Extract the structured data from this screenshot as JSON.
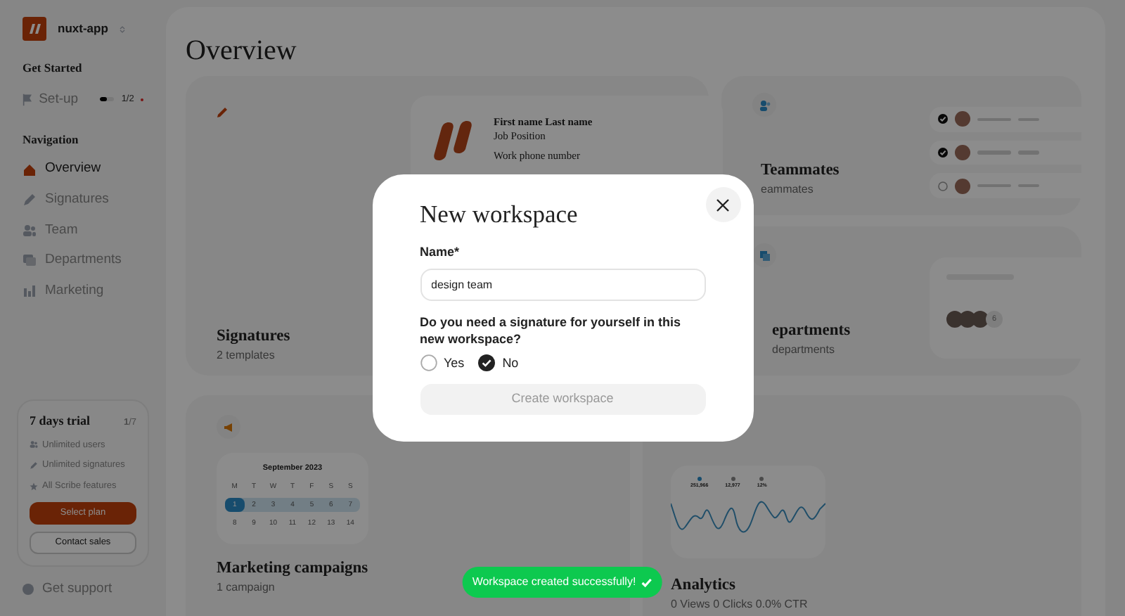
{
  "sidebar": {
    "app_name": "nuxt-app",
    "setup": {
      "heading": "Get Started",
      "label": "Set-up",
      "level": 0.5,
      "progress": "1/2"
    },
    "nav_heading": "Navigation",
    "nav": [
      {
        "label": "Overview",
        "selected": true
      },
      {
        "label": "Signatures",
        "selected": false
      },
      {
        "label": "Team",
        "selected": false
      },
      {
        "label": "Departments",
        "selected": false
      },
      {
        "label": "Marketing",
        "selected": false
      }
    ],
    "trial": {
      "title": "7 days trial",
      "day": "**1**/7",
      "features": [
        "Unlimited users",
        "Unlimited signatures",
        "All Scribe features"
      ],
      "primary": "Select plan",
      "secondary": "Contact sales"
    },
    "support": "Get support"
  },
  "page_title": "Overview",
  "signatures": {
    "title": "Signatures",
    "subtitle": "2 templates",
    "preview": {
      "name": "First name Last name",
      "position": "Job Position",
      "phone": "Work phone number"
    }
  },
  "teammates": {
    "title": "Teammates",
    "subtitle": "eammates",
    "rows": [
      {
        "checked": true
      },
      {
        "checked": true
      },
      {
        "checked": false
      }
    ]
  },
  "departments": {
    "title": "epartments",
    "subtitle": "departments",
    "more": "6"
  },
  "marketing": {
    "title": "Marketing campaigns",
    "subtitle": "1 campaign",
    "calendar": {
      "month": "September 2023",
      "weekdays": [
        "M",
        "T",
        "W",
        "T",
        "F",
        "S",
        "S"
      ],
      "weeks": [
        {
          "highlighted": true,
          "days": [
            {
              "label": "1",
              "selected": true
            },
            {
              "label": "2",
              "selected": false
            },
            {
              "label": "3",
              "selected": false
            },
            {
              "label": "4",
              "selected": false
            },
            {
              "label": "5",
              "selected": false
            },
            {
              "label": "6",
              "selected": false
            },
            {
              "label": "7",
              "selected": false
            }
          ]
        },
        {
          "highlighted": false,
          "days": [
            {
              "label": "8",
              "selected": false
            },
            {
              "label": "9",
              "selected": false
            },
            {
              "label": "10",
              "selected": false
            },
            {
              "label": "11",
              "selected": false
            },
            {
              "label": "12",
              "selected": false
            },
            {
              "label": "13",
              "selected": false
            },
            {
              "label": "14",
              "selected": false
            }
          ]
        }
      ]
    }
  },
  "analytics": {
    "title": "Analytics",
    "summary": "0 Views 0 Clicks 0.0% CTR",
    "stats": [
      "251,966",
      "12,977",
      "12%"
    ]
  },
  "modal": {
    "title": "New workspace",
    "name_label": "Name*",
    "name_value": "design team",
    "question": "Do you need a signature for yourself in this new workspace?",
    "options": [
      {
        "label": "Yes",
        "selected": false
      },
      {
        "label": "No",
        "selected": true
      }
    ],
    "submit": {
      "label": "Create workspace",
      "disabled": true
    }
  },
  "toast": {
    "message": "Workspace created successfully!"
  }
}
